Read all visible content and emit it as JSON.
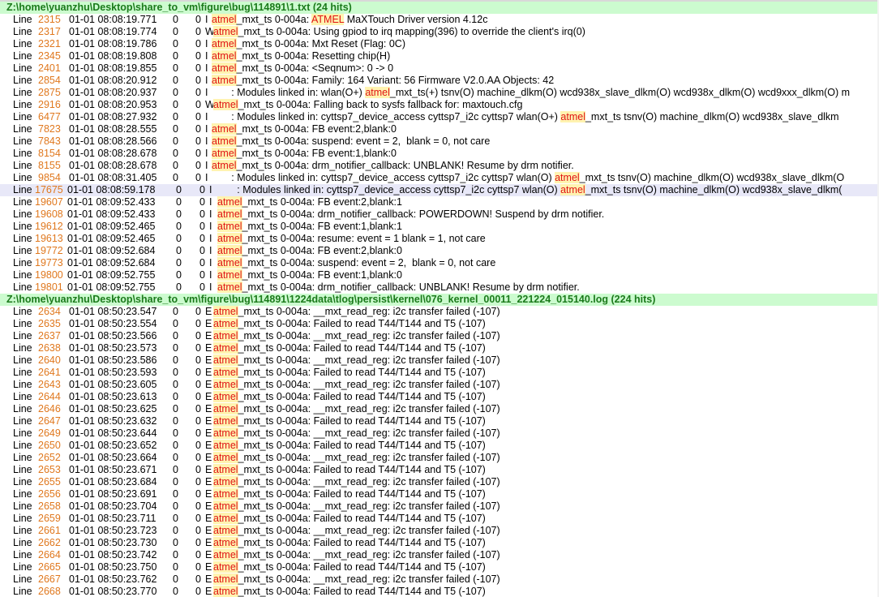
{
  "search_term": "atmel",
  "groups": [
    {
      "header": "Z:\\home\\yuanzhu\\Desktop\\share_to_vm\\figure\\bug\\114891\\1.txt (24 hits)",
      "rows": [
        {
          "label": "Line",
          "num": "2315",
          "ts": "01-01 08:08:19.771",
          "pid": "0",
          "tid": "0",
          "level": "I",
          "pre": "",
          "hit": "atmel",
          "post": "_mxt_ts 0-004a: ",
          "hit2": "ATMEL",
          "post2": " MaXTouch Driver version 4.12c"
        },
        {
          "label": "Line",
          "num": "2317",
          "ts": "01-01 08:08:19.774",
          "pid": "0",
          "tid": "0",
          "level": "W",
          "pre": "",
          "hit": "atmel",
          "post": "_mxt_ts 0-004a: Using gpiod to irq mapping(396) to override the client's irq(0)"
        },
        {
          "label": "Line",
          "num": "2321",
          "ts": "01-01 08:08:19.786",
          "pid": "0",
          "tid": "0",
          "level": "I",
          "pre": "",
          "hit": "atmel",
          "post": "_mxt_ts 0-004a: Mxt Reset (Flag: 0C)"
        },
        {
          "label": "Line",
          "num": "2345",
          "ts": "01-01 08:08:19.808",
          "pid": "0",
          "tid": "0",
          "level": "I",
          "pre": "",
          "hit": "atmel",
          "post": "_mxt_ts 0-004a: Resetting chip(H)"
        },
        {
          "label": "Line",
          "num": "2401",
          "ts": "01-01 08:08:19.855",
          "pid": "0",
          "tid": "0",
          "level": "I",
          "pre": "",
          "hit": "atmel",
          "post": "_mxt_ts 0-004a: <Seqnum>: 0 -> 0"
        },
        {
          "label": "Line",
          "num": "2854",
          "ts": "01-01 08:08:20.912",
          "pid": "0",
          "tid": "0",
          "level": "I",
          "pre": "",
          "hit": "atmel",
          "post": "_mxt_ts 0-004a: Family: 164 Variant: 56 Firmware V2.0.AA Objects: 42"
        },
        {
          "label": "Line",
          "num": "2875",
          "ts": "01-01 08:08:20.937",
          "pid": "0",
          "tid": "0",
          "level": "I",
          "pre": "       : Modules linked in: wlan(O+) ",
          "hit": "atmel",
          "post": "_mxt_ts(+) tsnv(O) machine_dlkm(O) wcd938x_slave_dlkm(O) wcd938x_dlkm(O) wcd9xxx_dlkm(O) m"
        },
        {
          "label": "Line",
          "num": "2916",
          "ts": "01-01 08:08:20.953",
          "pid": "0",
          "tid": "0",
          "level": "W",
          "pre": "",
          "hit": "atmel",
          "post": "_mxt_ts 0-004a: Falling back to sysfs fallback for: maxtouch.cfg"
        },
        {
          "label": "Line",
          "num": "6477",
          "ts": "01-01 08:08:27.932",
          "pid": "0",
          "tid": "0",
          "level": "I",
          "pre": "       : Modules linked in: cyttsp7_device_access cyttsp7_i2c cyttsp7 wlan(O+) ",
          "hit": "atmel",
          "post": "_mxt_ts tsnv(O) machine_dlkm(O) wcd938x_slave_dlkm"
        },
        {
          "label": "Line",
          "num": "7823",
          "ts": "01-01 08:08:28.555",
          "pid": "0",
          "tid": "0",
          "level": "I",
          "pre": "",
          "hit": "atmel",
          "post": "_mxt_ts 0-004a: FB event:2,blank:0"
        },
        {
          "label": "Line",
          "num": "7843",
          "ts": "01-01 08:08:28.566",
          "pid": "0",
          "tid": "0",
          "level": "I",
          "pre": "",
          "hit": "atmel",
          "post": "_mxt_ts 0-004a: suspend: event = 2,  blank = 0, not care"
        },
        {
          "label": "Line",
          "num": "8154",
          "ts": "01-01 08:08:28.678",
          "pid": "0",
          "tid": "0",
          "level": "I",
          "pre": "",
          "hit": "atmel",
          "post": "_mxt_ts 0-004a: FB event:1,blank:0"
        },
        {
          "label": "Line",
          "num": "8155",
          "ts": "01-01 08:08:28.678",
          "pid": "0",
          "tid": "0",
          "level": "I",
          "pre": "",
          "hit": "atmel",
          "post": "_mxt_ts 0-004a: drm_notifier_callback: UNBLANK! Resume by drm notifier."
        },
        {
          "label": "Line",
          "num": "9854",
          "ts": "01-01 08:08:31.405",
          "pid": "0",
          "tid": "0",
          "level": "I",
          "pre": "       : Modules linked in: cyttsp7_device_access cyttsp7_i2c cyttsp7 wlan(O) ",
          "hit": "atmel",
          "post": "_mxt_ts tsnv(O) machine_dlkm(O) wcd938x_slave_dlkm(O"
        },
        {
          "label": "Line",
          "num": "17675",
          "ts": "01-01 08:08:59.178",
          "pid": "0",
          "tid": "0",
          "level": "I",
          "pre": "       : Modules linked in: cyttsp7_device_access cyttsp7_i2c cyttsp7 wlan(O) ",
          "hit": "atmel",
          "post": "_mxt_ts tsnv(O) machine_dlkm(O) wcd938x_slave_dlkm(",
          "selected": true
        },
        {
          "label": "Line",
          "num": "19607",
          "ts": "01-01 08:09:52.433",
          "pid": "0",
          "tid": "0",
          "level": "I",
          "pre": "",
          "hit": "atmel",
          "post": "_mxt_ts 0-004a: FB event:2,blank:1"
        },
        {
          "label": "Line",
          "num": "19608",
          "ts": "01-01 08:09:52.433",
          "pid": "0",
          "tid": "0",
          "level": "I",
          "pre": "",
          "hit": "atmel",
          "post": "_mxt_ts 0-004a: drm_notifier_callback: POWERDOWN! Suspend by drm notifier."
        },
        {
          "label": "Line",
          "num": "19612",
          "ts": "01-01 08:09:52.465",
          "pid": "0",
          "tid": "0",
          "level": "I",
          "pre": "",
          "hit": "atmel",
          "post": "_mxt_ts 0-004a: FB event:1,blank:1"
        },
        {
          "label": "Line",
          "num": "19613",
          "ts": "01-01 08:09:52.465",
          "pid": "0",
          "tid": "0",
          "level": "I",
          "pre": "",
          "hit": "atmel",
          "post": "_mxt_ts 0-004a: resume: event = 1 blank = 1, not care"
        },
        {
          "label": "Line",
          "num": "19772",
          "ts": "01-01 08:09:52.684",
          "pid": "0",
          "tid": "0",
          "level": "I",
          "pre": "",
          "hit": "atmel",
          "post": "_mxt_ts 0-004a: FB event:2,blank:0"
        },
        {
          "label": "Line",
          "num": "19773",
          "ts": "01-01 08:09:52.684",
          "pid": "0",
          "tid": "0",
          "level": "I",
          "pre": "",
          "hit": "atmel",
          "post": "_mxt_ts 0-004a: suspend: event = 2,  blank = 0, not care"
        },
        {
          "label": "Line",
          "num": "19800",
          "ts": "01-01 08:09:52.755",
          "pid": "0",
          "tid": "0",
          "level": "I",
          "pre": "",
          "hit": "atmel",
          "post": "_mxt_ts 0-004a: FB event:1,blank:0"
        },
        {
          "label": "Line",
          "num": "19801",
          "ts": "01-01 08:09:52.755",
          "pid": "0",
          "tid": "0",
          "level": "I",
          "pre": "",
          "hit": "atmel",
          "post": "_mxt_ts 0-004a: drm_notifier_callback: UNBLANK! Resume by drm notifier."
        }
      ]
    },
    {
      "header": "Z:\\home\\yuanzhu\\Desktop\\share_to_vm\\figure\\bug\\114891\\1224data\\tlog\\persist\\kernel\\076_kernel_00011_221224_015140.log (224 hits)",
      "rows": [
        {
          "label": "Line",
          "num": "2634",
          "ts": "01-01 08:50:23.547",
          "pid": "0",
          "tid": "0",
          "level": "E",
          "pre": "",
          "hit": "atmel",
          "post": "_mxt_ts 0-004a: __mxt_read_reg: i2c transfer failed (-107)"
        },
        {
          "label": "Line",
          "num": "2635",
          "ts": "01-01 08:50:23.554",
          "pid": "0",
          "tid": "0",
          "level": "E",
          "pre": "",
          "hit": "atmel",
          "post": "_mxt_ts 0-004a: Failed to read T44/T144 and T5 (-107)"
        },
        {
          "label": "Line",
          "num": "2637",
          "ts": "01-01 08:50:23.566",
          "pid": "0",
          "tid": "0",
          "level": "E",
          "pre": "",
          "hit": "atmel",
          "post": "_mxt_ts 0-004a: __mxt_read_reg: i2c transfer failed (-107)"
        },
        {
          "label": "Line",
          "num": "2638",
          "ts": "01-01 08:50:23.573",
          "pid": "0",
          "tid": "0",
          "level": "E",
          "pre": "",
          "hit": "atmel",
          "post": "_mxt_ts 0-004a: Failed to read T44/T144 and T5 (-107)"
        },
        {
          "label": "Line",
          "num": "2640",
          "ts": "01-01 08:50:23.586",
          "pid": "0",
          "tid": "0",
          "level": "E",
          "pre": "",
          "hit": "atmel",
          "post": "_mxt_ts 0-004a: __mxt_read_reg: i2c transfer failed (-107)"
        },
        {
          "label": "Line",
          "num": "2641",
          "ts": "01-01 08:50:23.593",
          "pid": "0",
          "tid": "0",
          "level": "E",
          "pre": "",
          "hit": "atmel",
          "post": "_mxt_ts 0-004a: Failed to read T44/T144 and T5 (-107)"
        },
        {
          "label": "Line",
          "num": "2643",
          "ts": "01-01 08:50:23.605",
          "pid": "0",
          "tid": "0",
          "level": "E",
          "pre": "",
          "hit": "atmel",
          "post": "_mxt_ts 0-004a: __mxt_read_reg: i2c transfer failed (-107)"
        },
        {
          "label": "Line",
          "num": "2644",
          "ts": "01-01 08:50:23.613",
          "pid": "0",
          "tid": "0",
          "level": "E",
          "pre": "",
          "hit": "atmel",
          "post": "_mxt_ts 0-004a: Failed to read T44/T144 and T5 (-107)"
        },
        {
          "label": "Line",
          "num": "2646",
          "ts": "01-01 08:50:23.625",
          "pid": "0",
          "tid": "0",
          "level": "E",
          "pre": "",
          "hit": "atmel",
          "post": "_mxt_ts 0-004a: __mxt_read_reg: i2c transfer failed (-107)"
        },
        {
          "label": "Line",
          "num": "2647",
          "ts": "01-01 08:50:23.632",
          "pid": "0",
          "tid": "0",
          "level": "E",
          "pre": "",
          "hit": "atmel",
          "post": "_mxt_ts 0-004a: Failed to read T44/T144 and T5 (-107)"
        },
        {
          "label": "Line",
          "num": "2649",
          "ts": "01-01 08:50:23.644",
          "pid": "0",
          "tid": "0",
          "level": "E",
          "pre": "",
          "hit": "atmel",
          "post": "_mxt_ts 0-004a: __mxt_read_reg: i2c transfer failed (-107)"
        },
        {
          "label": "Line",
          "num": "2650",
          "ts": "01-01 08:50:23.652",
          "pid": "0",
          "tid": "0",
          "level": "E",
          "pre": "",
          "hit": "atmel",
          "post": "_mxt_ts 0-004a: Failed to read T44/T144 and T5 (-107)"
        },
        {
          "label": "Line",
          "num": "2652",
          "ts": "01-01 08:50:23.664",
          "pid": "0",
          "tid": "0",
          "level": "E",
          "pre": "",
          "hit": "atmel",
          "post": "_mxt_ts 0-004a: __mxt_read_reg: i2c transfer failed (-107)"
        },
        {
          "label": "Line",
          "num": "2653",
          "ts": "01-01 08:50:23.671",
          "pid": "0",
          "tid": "0",
          "level": "E",
          "pre": "",
          "hit": "atmel",
          "post": "_mxt_ts 0-004a: Failed to read T44/T144 and T5 (-107)"
        },
        {
          "label": "Line",
          "num": "2655",
          "ts": "01-01 08:50:23.684",
          "pid": "0",
          "tid": "0",
          "level": "E",
          "pre": "",
          "hit": "atmel",
          "post": "_mxt_ts 0-004a: __mxt_read_reg: i2c transfer failed (-107)"
        },
        {
          "label": "Line",
          "num": "2656",
          "ts": "01-01 08:50:23.691",
          "pid": "0",
          "tid": "0",
          "level": "E",
          "pre": "",
          "hit": "atmel",
          "post": "_mxt_ts 0-004a: Failed to read T44/T144 and T5 (-107)"
        },
        {
          "label": "Line",
          "num": "2658",
          "ts": "01-01 08:50:23.704",
          "pid": "0",
          "tid": "0",
          "level": "E",
          "pre": "",
          "hit": "atmel",
          "post": "_mxt_ts 0-004a: __mxt_read_reg: i2c transfer failed (-107)"
        },
        {
          "label": "Line",
          "num": "2659",
          "ts": "01-01 08:50:23.711",
          "pid": "0",
          "tid": "0",
          "level": "E",
          "pre": "",
          "hit": "atmel",
          "post": "_mxt_ts 0-004a: Failed to read T44/T144 and T5 (-107)"
        },
        {
          "label": "Line",
          "num": "2661",
          "ts": "01-01 08:50:23.723",
          "pid": "0",
          "tid": "0",
          "level": "E",
          "pre": "",
          "hit": "atmel",
          "post": "_mxt_ts 0-004a: __mxt_read_reg: i2c transfer failed (-107)"
        },
        {
          "label": "Line",
          "num": "2662",
          "ts": "01-01 08:50:23.730",
          "pid": "0",
          "tid": "0",
          "level": "E",
          "pre": "",
          "hit": "atmel",
          "post": "_mxt_ts 0-004a: Failed to read T44/T144 and T5 (-107)"
        },
        {
          "label": "Line",
          "num": "2664",
          "ts": "01-01 08:50:23.742",
          "pid": "0",
          "tid": "0",
          "level": "E",
          "pre": "",
          "hit": "atmel",
          "post": "_mxt_ts 0-004a: __mxt_read_reg: i2c transfer failed (-107)"
        },
        {
          "label": "Line",
          "num": "2665",
          "ts": "01-01 08:50:23.750",
          "pid": "0",
          "tid": "0",
          "level": "E",
          "pre": "",
          "hit": "atmel",
          "post": "_mxt_ts 0-004a: Failed to read T44/T144 and T5 (-107)"
        },
        {
          "label": "Line",
          "num": "2667",
          "ts": "01-01 08:50:23.762",
          "pid": "0",
          "tid": "0",
          "level": "E",
          "pre": "",
          "hit": "atmel",
          "post": "_mxt_ts 0-004a: __mxt_read_reg: i2c transfer failed (-107)"
        },
        {
          "label": "Line",
          "num": "2668",
          "ts": "01-01 08:50:23.770",
          "pid": "0",
          "tid": "0",
          "level": "E",
          "pre": "",
          "hit": "atmel",
          "post": "_mxt_ts 0-004a: Failed to read T44/T144 and T5 (-107)"
        }
      ]
    }
  ],
  "colors": {
    "header_bg": "#ccfbcf",
    "header_text": "#1b7a1b",
    "line_number": "#e0781e",
    "hit_text": "#e01414",
    "hit_bg": "#fff3b0",
    "selected_row_bg": "#e8e8f8"
  }
}
